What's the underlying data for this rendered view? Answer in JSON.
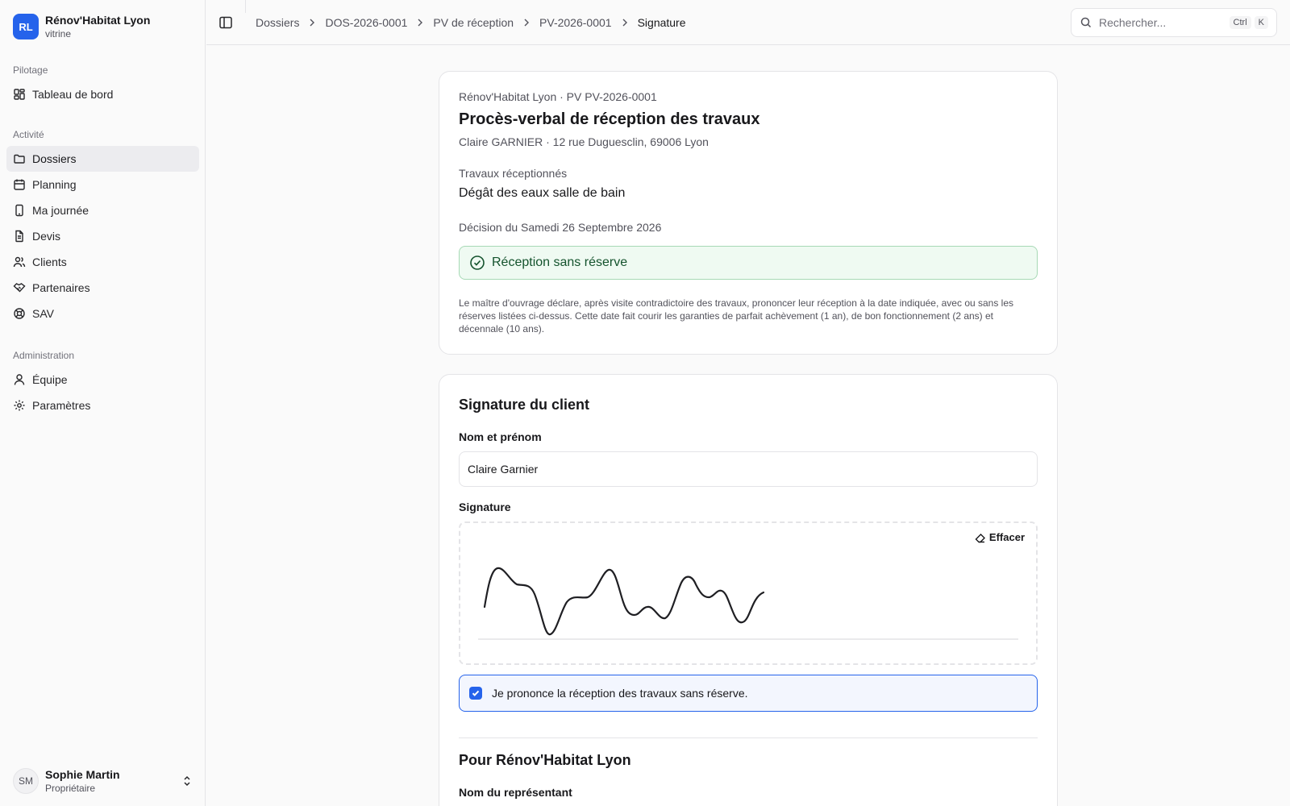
{
  "brand": {
    "initials": "RL",
    "name": "Rénov'Habitat Lyon",
    "subtitle": "vitrine",
    "accent": "#2563eb"
  },
  "sidebar": {
    "groups": [
      {
        "label": "Pilotage",
        "items": [
          {
            "label": "Tableau de bord",
            "icon": "dashboard-icon"
          }
        ]
      },
      {
        "label": "Activité",
        "items": [
          {
            "label": "Dossiers",
            "icon": "folder-icon",
            "active": true
          },
          {
            "label": "Planning",
            "icon": "calendar-icon"
          },
          {
            "label": "Ma journée",
            "icon": "phone-icon"
          },
          {
            "label": "Devis",
            "icon": "document-icon"
          },
          {
            "label": "Clients",
            "icon": "users-icon"
          },
          {
            "label": "Partenaires",
            "icon": "handshake-icon"
          },
          {
            "label": "SAV",
            "icon": "lifebuoy-icon"
          }
        ]
      },
      {
        "label": "Administration",
        "items": [
          {
            "label": "Équipe",
            "icon": "user-icon"
          },
          {
            "label": "Paramètres",
            "icon": "gear-icon"
          }
        ]
      }
    ]
  },
  "user": {
    "initials": "SM",
    "name": "Sophie Martin",
    "role": "Propriétaire"
  },
  "breadcrumbs": [
    "Dossiers",
    "DOS-2026-0001",
    "PV de réception",
    "PV-2026-0001",
    "Signature"
  ],
  "search": {
    "placeholder": "Rechercher...",
    "shortcut": [
      "Ctrl",
      "K"
    ]
  },
  "pv": {
    "meta": "Rénov'Habitat Lyon · PV PV-2026-0001",
    "title": "Procès-verbal de réception des travaux",
    "client_line": "Claire GARNIER · 12 rue Duguesclin, 69006 Lyon",
    "works_label": "Travaux réceptionnés",
    "works_value": "Dégât des eaux salle de bain",
    "decision_label": "Décision du Samedi 26 Septembre 2026",
    "decision_value": "Réception sans réserve",
    "decision_color": "#16a34a",
    "legal_text": "Le maître d'ouvrage déclare, après visite contradictoire des travaux, prononcer leur réception à la date indiquée, avec ou sans les réserves listées ci-dessus. Cette date fait courir les garanties de parfait achèvement (1 an), de bon fonctionnement (2 ans) et décennale (10 ans)."
  },
  "signature": {
    "heading": "Signature du client",
    "name_label": "Nom et prénom",
    "name_value": "Claire Garnier",
    "signature_label": "Signature",
    "clear_label": "Effacer",
    "consent_label": "Je prononce la réception des travaux sans réserve.",
    "consent_checked": true,
    "company_heading": "Pour Rénov'Habitat Lyon",
    "rep_label": "Nom du représentant"
  }
}
